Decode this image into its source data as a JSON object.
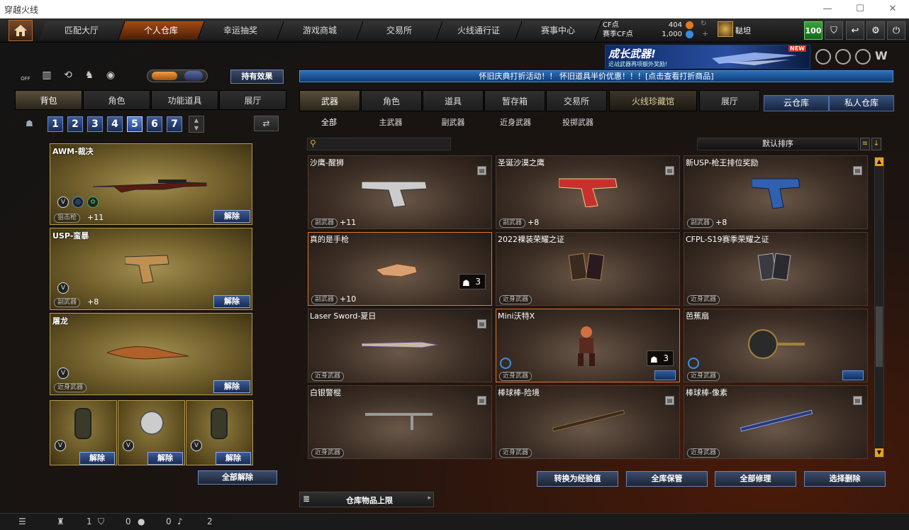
{
  "window": {
    "title": "穿越火线",
    "min": "—",
    "max": "☐",
    "close": "✕"
  },
  "nav": {
    "tabs": [
      "匹配大厅",
      "个人仓库",
      "幸运抽奖",
      "游戏商城",
      "交易所",
      "火线通行证",
      "赛事中心"
    ],
    "active": 1
  },
  "currency": {
    "cf_label": "CF点",
    "cf_value": "404",
    "event_label": "赛季CF点",
    "event_value": "1,000",
    "username": "鞑坦"
  },
  "topright": {
    "level": "100"
  },
  "banner": {
    "title": "成长武器!",
    "subtitle": "近战武器再项额外奖励!",
    "new_badge": "NEW"
  },
  "notice": "怀旧庆典打折活动！！ 怀旧道具半价优惠！！！[点击查看打折商品]",
  "left": {
    "toggle_label": "OFF",
    "effect_button": "持有效果",
    "tabs": [
      "背包",
      "角色",
      "功能道具",
      "展厅"
    ],
    "slots": [
      "1",
      "2",
      "3",
      "4",
      "5",
      "6",
      "7"
    ],
    "active_slot": 4,
    "cards": [
      {
        "name": "AWM-裁决",
        "tag": "狙击枪",
        "plus": "+11",
        "unequip": "解除"
      },
      {
        "name": "USP-蛮暴",
        "tag": "副武器",
        "plus": "+8",
        "unequip": "解除"
      },
      {
        "name": "屠龙",
        "tag": "近身武器",
        "unequip": "解除"
      }
    ],
    "grenades": [
      {
        "unequip": "解除"
      },
      {
        "unequip": "解除"
      },
      {
        "unequip": "解除"
      }
    ],
    "all_unequip": "全部解除"
  },
  "right": {
    "tabs": [
      "武器",
      "角色",
      "道具",
      "暂存箱",
      "交易所",
      "火线珍藏馆",
      "展厅"
    ],
    "active_tab": 0,
    "cloud_tabs": [
      "云仓库",
      "私人仓库"
    ],
    "subtabs": [
      "全部",
      "主武器",
      "副武器",
      "近身武器",
      "投掷武器"
    ],
    "active_subtab": 0,
    "search_placeholder": "",
    "sort_label": "默认排序",
    "items": [
      {
        "name": "沙鹰-醒狮",
        "tag": "副武器",
        "plus": "+11"
      },
      {
        "name": "圣诞沙漠之鹰",
        "tag": "副武器",
        "plus": "+8"
      },
      {
        "name": "新USP-枪王排位奖励",
        "tag": "副武器",
        "plus": "+8"
      },
      {
        "name": "真的是手枪",
        "tag": "副武器",
        "plus": "+10",
        "qty": "3"
      },
      {
        "name": "2022裸装荣耀之证",
        "tag": "近身武器"
      },
      {
        "name": "CFPL-S19赛季荣耀之证",
        "tag": "近身武器"
      },
      {
        "name": "Laser Sword-夏日",
        "tag": "近身武器"
      },
      {
        "name": "Mini沃特X",
        "tag": "近身武器",
        "qty": "3"
      },
      {
        "name": "芭蕉扇",
        "tag": "近身武器"
      },
      {
        "name": "白银警棍",
        "tag": "近身武器"
      },
      {
        "name": "棒球棒-险境",
        "tag": "近身武器"
      },
      {
        "name": "棒球棒-像素",
        "tag": "近身武器"
      }
    ],
    "actions": [
      "转换为经验值",
      "全库保管",
      "全部修理",
      "选择删除"
    ],
    "capacity_label": "仓库物品上限"
  },
  "status": {
    "friends": "1",
    "shield": "0",
    "chat": "0",
    "volume": "2"
  }
}
